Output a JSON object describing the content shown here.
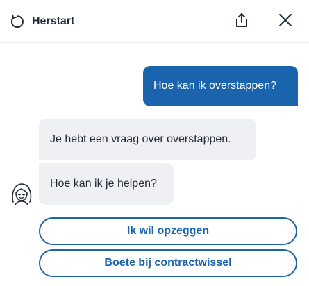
{
  "header": {
    "restart_label": "Herstart",
    "restart_icon": "restart-icon",
    "share_icon": "share-icon",
    "close_icon": "close-icon"
  },
  "conversation": {
    "user_message": "Hoe kan ik overstappen?",
    "bot_messages": [
      "Je hebt een vraag over overstappen.",
      "Hoe kan ik je helpen?"
    ],
    "bot_avatar_icon": "agent-avatar-icon"
  },
  "quick_replies": [
    "Ik wil opzeggen",
    "Boete bij contractwissel"
  ],
  "colors": {
    "accent": "#1a63ad",
    "bot_bubble": "#eef0f4",
    "text": "#1f2937"
  }
}
